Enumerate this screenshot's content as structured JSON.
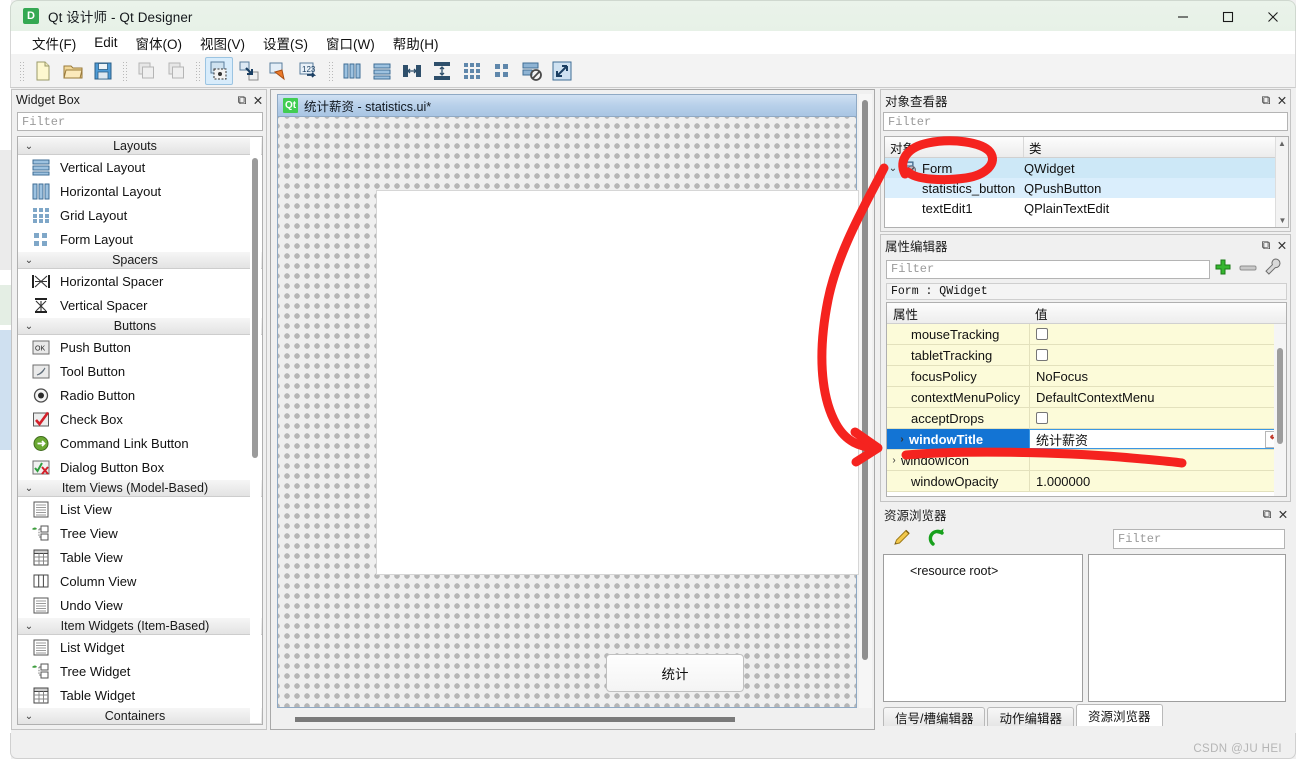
{
  "window": {
    "app_icon_letter": "D",
    "title": "Qt 设计师 - Qt Designer",
    "minimize_label": "—",
    "maximize_label": "▢",
    "close_label": "✕"
  },
  "menubar": {
    "items": [
      {
        "label": "文件(F)"
      },
      {
        "label": "Edit"
      },
      {
        "label": "窗体(O)"
      },
      {
        "label": "视图(V)"
      },
      {
        "label": "设置(S)"
      },
      {
        "label": "窗口(W)"
      },
      {
        "label": "帮助(H)"
      }
    ]
  },
  "toolbar": {
    "buttons": [
      {
        "name": "new-form",
        "icon": "new-file-icon"
      },
      {
        "name": "open-form",
        "icon": "open-folder-icon"
      },
      {
        "name": "save-form",
        "icon": "save-disk-icon"
      },
      {
        "name": "undo",
        "icon": "undo-icon"
      },
      {
        "name": "redo",
        "icon": "redo-icon"
      },
      {
        "name": "edit-widgets",
        "icon": "edit-widgets-icon",
        "active": true
      },
      {
        "name": "edit-signals-slots",
        "icon": "signal-slot-icon"
      },
      {
        "name": "edit-buddies",
        "icon": "buddy-icon"
      },
      {
        "name": "edit-tab-order",
        "icon": "tab-order-icon"
      },
      {
        "name": "layout-horizontally",
        "icon": "layout-horizontal-icon"
      },
      {
        "name": "layout-vertically",
        "icon": "layout-vertical-icon"
      },
      {
        "name": "layout-splitter-horizontal",
        "icon": "splitter-h-icon"
      },
      {
        "name": "layout-splitter-vertical",
        "icon": "splitter-v-icon"
      },
      {
        "name": "layout-grid",
        "icon": "grid-layout-icon"
      },
      {
        "name": "layout-form",
        "icon": "form-layout-icon"
      },
      {
        "name": "break-layout",
        "icon": "break-layout-icon"
      },
      {
        "name": "adjust-size",
        "icon": "adjust-size-icon"
      }
    ]
  },
  "widget_box": {
    "title": "Widget Box",
    "filter_placeholder": "Filter",
    "float_label": "⧉",
    "close_label": "✕",
    "groups": [
      {
        "title": "Layouts",
        "items": [
          {
            "label": "Vertical Layout",
            "icon": "vertical-layout-icon"
          },
          {
            "label": "Horizontal Layout",
            "icon": "horizontal-layout-icon"
          },
          {
            "label": "Grid Layout",
            "icon": "grid-layout-icon"
          },
          {
            "label": "Form Layout",
            "icon": "form-layout-icon"
          }
        ]
      },
      {
        "title": "Spacers",
        "items": [
          {
            "label": "Horizontal Spacer",
            "icon": "horizontal-spacer-icon"
          },
          {
            "label": "Vertical Spacer",
            "icon": "vertical-spacer-icon"
          }
        ]
      },
      {
        "title": "Buttons",
        "items": [
          {
            "label": "Push Button",
            "icon": "push-button-icon"
          },
          {
            "label": "Tool Button",
            "icon": "tool-button-icon"
          },
          {
            "label": "Radio Button",
            "icon": "radio-button-icon"
          },
          {
            "label": "Check Box",
            "icon": "check-box-icon"
          },
          {
            "label": "Command Link Button",
            "icon": "command-link-icon"
          },
          {
            "label": "Dialog Button Box",
            "icon": "dialog-button-box-icon"
          }
        ]
      },
      {
        "title": "Item Views (Model-Based)",
        "items": [
          {
            "label": "List View",
            "icon": "list-view-icon"
          },
          {
            "label": "Tree View",
            "icon": "tree-view-icon"
          },
          {
            "label": "Table View",
            "icon": "table-view-icon"
          },
          {
            "label": "Column View",
            "icon": "column-view-icon"
          },
          {
            "label": "Undo View",
            "icon": "undo-view-icon"
          }
        ]
      },
      {
        "title": "Item Widgets (Item-Based)",
        "items": [
          {
            "label": "List Widget",
            "icon": "list-widget-icon"
          },
          {
            "label": "Tree Widget",
            "icon": "tree-widget-icon"
          },
          {
            "label": "Table Widget",
            "icon": "table-widget-icon"
          }
        ]
      },
      {
        "title": "Containers",
        "items": []
      }
    ]
  },
  "form_window": {
    "qt_icon_label": "Qt",
    "title": "统计薪资 - statistics.ui*",
    "button": {
      "label": "统计"
    }
  },
  "object_inspector": {
    "title": "对象查看器",
    "filter_placeholder": "Filter",
    "float_label": "⧉",
    "close_label": "✕",
    "columns": [
      "对象",
      "类"
    ],
    "rows": [
      {
        "name": "Form",
        "class": "QWidget",
        "selected": true,
        "level": 0,
        "expander": "⌄"
      },
      {
        "name": "statistics_button",
        "class": "QPushButton",
        "selected": false,
        "level": 1
      },
      {
        "name": "textEdit1",
        "class": "QPlainTextEdit",
        "selected": false,
        "level": 1
      }
    ]
  },
  "property_editor": {
    "title": "属性编辑器",
    "filter_placeholder": "Filter",
    "float_label": "⧉",
    "close_label": "✕",
    "object_line": "Form : QWidget",
    "add_label": "+",
    "remove_label": "—",
    "configure_label": "🔧",
    "columns": [
      "属性",
      "值"
    ],
    "rows": [
      {
        "name": "mouseTracking",
        "value": "",
        "type": "checkbox",
        "checked": false
      },
      {
        "name": "tabletTracking",
        "value": "",
        "type": "checkbox",
        "checked": false
      },
      {
        "name": "focusPolicy",
        "value": "NoFocus",
        "type": "text"
      },
      {
        "name": "contextMenuPolicy",
        "value": "DefaultContextMenu",
        "type": "text"
      },
      {
        "name": "acceptDrops",
        "value": "",
        "type": "checkbox",
        "checked": false
      },
      {
        "name": "windowTitle",
        "value": "统计薪资",
        "type": "edit",
        "selected": true,
        "expandable": true
      },
      {
        "name": "windowIcon",
        "value": "",
        "type": "text",
        "expandable": true
      },
      {
        "name": "windowOpacity",
        "value": "1.000000",
        "type": "text"
      }
    ]
  },
  "resource_browser": {
    "title": "资源浏览器",
    "float_label": "⧉",
    "close_label": "✕",
    "edit_icon": "pencil-icon",
    "reload_icon": "reload-icon",
    "filter_placeholder": "Filter",
    "root_label": "<resource root>",
    "tabs": [
      {
        "label": "信号/槽编辑器",
        "active": false
      },
      {
        "label": "动作编辑器",
        "active": false
      },
      {
        "label": "资源浏览器",
        "active": true
      }
    ]
  },
  "annotation": {
    "color": "#f5231f",
    "shapes": [
      "ellipse-around-form-row",
      "curved-arrow-to-windowtitle",
      "underline-window-title-value"
    ]
  },
  "watermark": {
    "text": "CSDN @JU HEI"
  }
}
